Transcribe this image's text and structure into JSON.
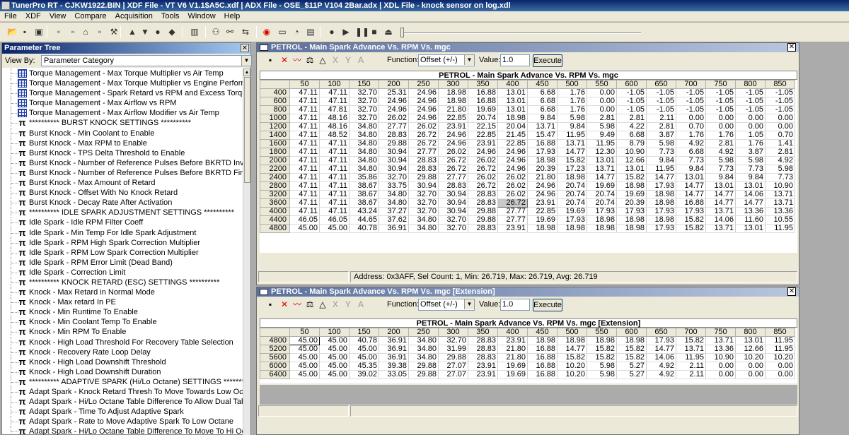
{
  "app": {
    "title": "TunerPro RT - CJKW1922.BIN | XDF File - VT V6 V1.1$A5C.xdf | ADX File - OSE_$11P V104 2Bar.adx | XDL File - knock sensor on log.xdl"
  },
  "menu": [
    "File",
    "XDF",
    "View",
    "Compare",
    "Acquisition",
    "Tools",
    "Window",
    "Help"
  ],
  "toolbar_icons": [
    "open-icon",
    "save-icon",
    "save-all-icon",
    "document-icon",
    "document-icon",
    "home-icon",
    "document-icon",
    "wrench-icon",
    "up-arrow-icon",
    "down-arrow-icon",
    "circle-icon",
    "tag-icon",
    "chip-icon",
    "connect-icon",
    "link-icon",
    "compare-icon",
    "record-icon",
    "folder-icon",
    "gauge-icon",
    "chart-icon",
    "stop-circle-icon",
    "play-icon",
    "pause-icon",
    "stop-icon",
    "eject-icon"
  ],
  "param_tree": {
    "title": "Parameter Tree",
    "view_by_label": "View By:",
    "view_by_value": "Parameter Category",
    "items": [
      {
        "icon": "table",
        "label": "Torque Management - Max Torque Multiplier vs Air Temp"
      },
      {
        "icon": "table",
        "label": "Torque Management - Max Torque Multiplier vs Engine Performance"
      },
      {
        "icon": "table",
        "label": "Torque Management - Spark Retard vs RPM and Excess Torque"
      },
      {
        "icon": "table",
        "label": "Torque Management - Max Airflow vs RPM"
      },
      {
        "icon": "table",
        "label": "Torque Management - Max Airflow Modifier vs Air Temp"
      },
      {
        "icon": "pi",
        "label": "********** BURST KNOCK SETTINGS **********"
      },
      {
        "icon": "pi",
        "label": "Burst Knock - Min Coolant to Enable"
      },
      {
        "icon": "pi",
        "label": "Burst Knock - Max RPM to Enable"
      },
      {
        "icon": "pi",
        "label": "Burst Knock - TPS Delta Threshold to Enable"
      },
      {
        "icon": "pi",
        "label": "Burst Knock - Number of Reference Pulses Before BKRTD Invoked"
      },
      {
        "icon": "pi",
        "label": "Burst Knock - Number of Reference Pulses Before BKRTD Finishes"
      },
      {
        "icon": "pi",
        "label": "Burst Knock - Max Amount of Retard"
      },
      {
        "icon": "pi",
        "label": "Burst Knock - Offset With No Knock Retard"
      },
      {
        "icon": "pi",
        "label": "Burst Knock - Decay Rate After Activation"
      },
      {
        "icon": "pi",
        "label": "********** IDLE SPARK ADJUSTMENT SETTINGS **********"
      },
      {
        "icon": "pi",
        "label": "Idle Spark - Idle RPM Filter Coeff"
      },
      {
        "icon": "pi",
        "label": "Idle Spark - Min Temp For Idle Spark Adjustment"
      },
      {
        "icon": "pi",
        "label": "Idle Spark - RPM High Spark Correction Multiplier"
      },
      {
        "icon": "pi",
        "label": "Idle Spark - RPM Low Spark Correction Multiplier"
      },
      {
        "icon": "pi",
        "label": "Idle Spark - RPM Error Limit (Dead Band)"
      },
      {
        "icon": "pi",
        "label": "Idle Spark - Correction Limit"
      },
      {
        "icon": "pi",
        "label": "********** KNOCK RETARD (ESC) SETTINGS **********"
      },
      {
        "icon": "pi",
        "label": "Knock - Max Retard in Normal Mode"
      },
      {
        "icon": "pi",
        "label": "Knock - Max retard In PE"
      },
      {
        "icon": "pi",
        "label": "Knock - Min Runtime To Enable"
      },
      {
        "icon": "pi",
        "label": "Knock - Min Coolant Temp To Enable"
      },
      {
        "icon": "pi",
        "label": "Knock - Min RPM To Enable"
      },
      {
        "icon": "pi",
        "label": "Knock - High Load Threshold For Recovery Table Selection"
      },
      {
        "icon": "pi",
        "label": "Knock - Recovery Rate Loop Delay"
      },
      {
        "icon": "pi",
        "label": "Knock - High Load Downshift Threshold"
      },
      {
        "icon": "pi",
        "label": "Knock - High Load Downshift Duration"
      },
      {
        "icon": "pi",
        "label": "********** ADAPTIVE SPARK (Hi/Lo Octane) SETTINGS **********"
      },
      {
        "icon": "pi",
        "label": "Adapt Spark - Knock Retard Thresh To Move Towards Low Octane Table"
      },
      {
        "icon": "pi",
        "label": "Adapt Spark - Hi/Lo Octane Table Difference To Allow Dual Tables"
      },
      {
        "icon": "pi",
        "label": "Adapt Spark - Time To Adjust Adaptive Spark"
      },
      {
        "icon": "pi",
        "label": "Adapt Spark - Rate to Move Adaptive Spark To Low Octane"
      },
      {
        "icon": "pi",
        "label": "Adapt Spark - Hi/Lo Octane Table Difference To Move To Hi Octane"
      }
    ]
  },
  "window1": {
    "title": "PETROL - Main Spark Advance Vs. RPM Vs. mgc",
    "function_label": "Function:",
    "function_value": "Offset (+/-)",
    "value_label": "Value:",
    "value": "1.0",
    "execute_label": "Execute",
    "grid_title": "PETROL - Main Spark Advance Vs. RPM Vs. mgc",
    "columns": [
      "50",
      "100",
      "150",
      "200",
      "250",
      "300",
      "350",
      "400",
      "450",
      "500",
      "550",
      "600",
      "650",
      "700",
      "750",
      "800",
      "850"
    ],
    "rows": [
      {
        "rpm": "400",
        "v": [
          "47.11",
          "47.11",
          "32.70",
          "25.31",
          "24.96",
          "18.98",
          "16.88",
          "13.01",
          "6.68",
          "1.76",
          "0.00",
          "-1.05",
          "-1.05",
          "-1.05",
          "-1.05",
          "-1.05",
          "-1.05"
        ]
      },
      {
        "rpm": "600",
        "v": [
          "47.11",
          "47.11",
          "32.70",
          "24.96",
          "24.96",
          "18.98",
          "16.88",
          "13.01",
          "6.68",
          "1.76",
          "0.00",
          "-1.05",
          "-1.05",
          "-1.05",
          "-1.05",
          "-1.05",
          "-1.05"
        ]
      },
      {
        "rpm": "800",
        "v": [
          "47.11",
          "47.81",
          "32.70",
          "24.96",
          "24.96",
          "21.80",
          "19.69",
          "13.01",
          "6.68",
          "1.76",
          "0.00",
          "-1.05",
          "-1.05",
          "-1.05",
          "-1.05",
          "-1.05",
          "-1.05"
        ]
      },
      {
        "rpm": "1000",
        "v": [
          "47.11",
          "48.16",
          "32.70",
          "26.02",
          "24.96",
          "22.85",
          "20.74",
          "18.98",
          "9.84",
          "5.98",
          "2.81",
          "2.81",
          "2.11",
          "0.00",
          "0.00",
          "0.00",
          "0.00"
        ]
      },
      {
        "rpm": "1200",
        "v": [
          "47.11",
          "48.16",
          "34.80",
          "27.77",
          "26.02",
          "23.91",
          "22.15",
          "20.04",
          "13.71",
          "9.84",
          "5.98",
          "4.22",
          "2.81",
          "0.70",
          "0.00",
          "0.00",
          "0.00"
        ]
      },
      {
        "rpm": "1400",
        "v": [
          "47.11",
          "48.52",
          "34.80",
          "28.83",
          "26.72",
          "24.96",
          "22.85",
          "21.45",
          "15.47",
          "11.95",
          "9.49",
          "6.68",
          "3.87",
          "1.76",
          "1.76",
          "1.05",
          "0.70"
        ]
      },
      {
        "rpm": "1600",
        "v": [
          "47.11",
          "47.11",
          "34.80",
          "29.88",
          "26.72",
          "24.96",
          "23.91",
          "22.85",
          "16.88",
          "13.71",
          "11.95",
          "8.79",
          "5.98",
          "4.92",
          "2.81",
          "1.76",
          "1.41"
        ]
      },
      {
        "rpm": "1800",
        "v": [
          "47.11",
          "47.11",
          "34.80",
          "30.94",
          "27.77",
          "26.02",
          "24.96",
          "24.96",
          "17.93",
          "14.77",
          "12.30",
          "10.90",
          "7.73",
          "6.68",
          "4.92",
          "3.87",
          "2.81"
        ]
      },
      {
        "rpm": "2000",
        "v": [
          "47.11",
          "47.11",
          "34.80",
          "30.94",
          "28.83",
          "26.72",
          "26.02",
          "24.96",
          "18.98",
          "15.82",
          "13.01",
          "12.66",
          "9.84",
          "7.73",
          "5.98",
          "5.98",
          "4.92"
        ]
      },
      {
        "rpm": "2200",
        "v": [
          "47.11",
          "47.11",
          "34.80",
          "30.94",
          "28.83",
          "26.72",
          "26.72",
          "24.96",
          "20.39",
          "17.23",
          "13.71",
          "13.01",
          "11.95",
          "9.84",
          "7.73",
          "7.73",
          "5.98"
        ]
      },
      {
        "rpm": "2400",
        "v": [
          "47.11",
          "47.11",
          "35.86",
          "32.70",
          "29.88",
          "27.77",
          "26.02",
          "26.02",
          "21.80",
          "18.98",
          "14.77",
          "15.82",
          "14.77",
          "13.01",
          "9.84",
          "9.84",
          "7.73"
        ]
      },
      {
        "rpm": "2800",
        "v": [
          "47.11",
          "47.11",
          "38.67",
          "33.75",
          "30.94",
          "28.83",
          "26.72",
          "26.02",
          "24.96",
          "20.74",
          "19.69",
          "18.98",
          "17.93",
          "14.77",
          "13.01",
          "13.01",
          "10.90"
        ]
      },
      {
        "rpm": "3200",
        "v": [
          "47.11",
          "47.11",
          "38.67",
          "34.80",
          "32.70",
          "30.94",
          "28.83",
          "26.02",
          "24.96",
          "20.74",
          "20.74",
          "19.69",
          "18.98",
          "14.77",
          "14.77",
          "14.06",
          "13.71"
        ]
      },
      {
        "rpm": "3600",
        "v": [
          "47.11",
          "47.11",
          "38.67",
          "34.80",
          "32.70",
          "30.94",
          "28.83",
          "26.72",
          "23.91",
          "20.74",
          "20.74",
          "20.39",
          "18.98",
          "16.88",
          "14.77",
          "14.77",
          "13.71"
        ]
      },
      {
        "rpm": "4000",
        "v": [
          "47.11",
          "47.11",
          "43.24",
          "37.27",
          "32.70",
          "30.94",
          "29.88",
          "27.77",
          "22.85",
          "19.69",
          "17.93",
          "17.93",
          "17.93",
          "17.93",
          "13.71",
          "13.36",
          "13.36"
        ]
      },
      {
        "rpm": "4400",
        "v": [
          "46.05",
          "46.05",
          "44.65",
          "37.62",
          "34.80",
          "32.70",
          "29.88",
          "27.77",
          "19.69",
          "17.93",
          "18.98",
          "18.98",
          "18.98",
          "15.82",
          "14.06",
          "11.60",
          "10.55"
        ]
      },
      {
        "rpm": "4800",
        "v": [
          "45.00",
          "45.00",
          "40.78",
          "36.91",
          "34.80",
          "32.70",
          "28.83",
          "23.91",
          "18.98",
          "18.98",
          "18.98",
          "18.98",
          "17.93",
          "15.82",
          "13.71",
          "13.01",
          "11.95"
        ]
      }
    ],
    "status": "Address: 0x3AFF, Sel Count: 1, Min: 26.719, Max: 26.719, Avg: 26.719"
  },
  "window2": {
    "title": "PETROL - Main Spark Advance Vs. RPM Vs. mgc [Extension]",
    "function_label": "Function:",
    "function_value": "Offset (+/-)",
    "value_label": "Value:",
    "value": "1.0",
    "execute_label": "Execute",
    "grid_title": "PETROL - Main Spark Advance Vs. RPM Vs. mgc [Extension]",
    "columns": [
      "50",
      "100",
      "150",
      "200",
      "250",
      "300",
      "350",
      "400",
      "450",
      "500",
      "550",
      "600",
      "650",
      "700",
      "750",
      "800",
      "850"
    ],
    "rows": [
      {
        "rpm": "4800",
        "v": [
          "45.00",
          "45.00",
          "40.78",
          "36.91",
          "34.80",
          "32.70",
          "28.83",
          "23.91",
          "18.98",
          "18.98",
          "18.98",
          "18.98",
          "17.93",
          "15.82",
          "13.71",
          "13.01",
          "11.95"
        ]
      },
      {
        "rpm": "5200",
        "v": [
          "45.00",
          "45.00",
          "45.00",
          "36.91",
          "34.80",
          "31.99",
          "28.83",
          "21.80",
          "16.88",
          "14.77",
          "15.82",
          "15.82",
          "14.77",
          "13.71",
          "13.36",
          "12.66",
          "11.95"
        ]
      },
      {
        "rpm": "5600",
        "v": [
          "45.00",
          "45.00",
          "45.00",
          "36.91",
          "34.80",
          "29.88",
          "28.83",
          "21.80",
          "16.88",
          "15.82",
          "15.82",
          "15.82",
          "14.06",
          "11.95",
          "10.90",
          "10.20",
          "10.20"
        ]
      },
      {
        "rpm": "6000",
        "v": [
          "45.00",
          "45.00",
          "45.35",
          "39.38",
          "29.88",
          "27.07",
          "23.91",
          "19.69",
          "16.88",
          "10.20",
          "5.98",
          "5.27",
          "4.92",
          "2.11",
          "0.00",
          "0.00",
          "0.00"
        ]
      },
      {
        "rpm": "6400",
        "v": [
          "45.00",
          "45.00",
          "39.02",
          "33.05",
          "29.88",
          "27.07",
          "23.91",
          "19.69",
          "16.88",
          "10.20",
          "5.98",
          "5.27",
          "4.92",
          "2.11",
          "0.00",
          "0.00",
          "0.00"
        ]
      }
    ]
  }
}
